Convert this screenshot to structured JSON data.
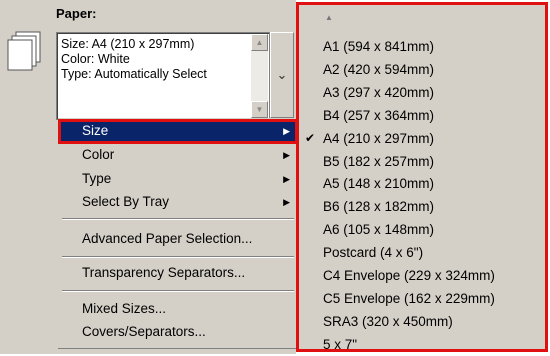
{
  "paper": {
    "label": "Paper:",
    "summary": [
      "Size: A4 (210 x 297mm)",
      "Color: White",
      "Type: Automatically Select"
    ]
  },
  "context_menu": {
    "items": [
      {
        "label": "Size",
        "submenu": true,
        "selected": true
      },
      {
        "label": "Color",
        "submenu": true
      },
      {
        "label": "Type",
        "submenu": true
      },
      {
        "label": "Select By Tray",
        "submenu": true
      },
      {
        "label": "Advanced Paper Selection..."
      },
      {
        "label": "Transparency Separators..."
      },
      {
        "label": "Mixed Sizes..."
      },
      {
        "label": "Covers/Separators..."
      }
    ]
  },
  "size_menu": {
    "options": [
      "A1 (594 x 841mm)",
      "A2 (420 x 594mm)",
      "A3 (297 x 420mm)",
      "B4 (257 x 364mm)",
      "A4 (210 x 297mm)",
      "B5 (182 x 257mm)",
      "A5 (148 x 210mm)",
      "B6 (128 x 182mm)",
      "A6 (105 x 148mm)",
      "Postcard (4 x 6\")",
      "C4 Envelope (229 x 324mm)",
      "C5 Envelope (162 x 229mm)",
      "SRA3 (320 x 450mm)",
      "5 x 7\""
    ],
    "checked": "A4 (210 x 297mm)"
  },
  "colors": {
    "highlight_border": "#e01010",
    "selection_bg": "#0a246a",
    "dialog_bg": "#d4d0c8"
  }
}
